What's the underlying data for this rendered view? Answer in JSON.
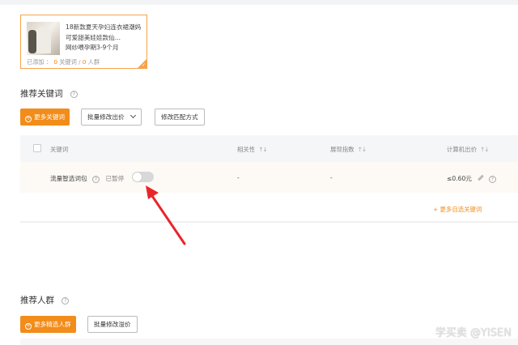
{
  "product": {
    "title": "18新款夏天孕妇连衣裙潮妈可爱甜美娃娃款仙...",
    "subtitle": "网纱喂孕期3-9个月",
    "added_label": "已添加 ：",
    "keyword_count": "0",
    "keyword_label": "关键词 /",
    "crowd_count": "0",
    "crowd_label": "人群"
  },
  "keywords_section": {
    "title": "推荐关键词",
    "add_button": "更多关键词",
    "bulk_bid_button": "批量修改出价",
    "match_button": "修改匹配方式"
  },
  "table": {
    "headers": {
      "keyword": "关键词",
      "relevance": "相关性",
      "impressions": "展现指数",
      "bid": "计算机出价"
    },
    "rows": [
      {
        "keyword": "流量智选词包",
        "status": "已暂停",
        "relevance": "-",
        "impressions": "-",
        "bid": "≤0.60元"
      }
    ]
  },
  "more_keywords_link": "+ 更多自选关键词",
  "crowd_section": {
    "title": "推荐人群",
    "add_button": "更多精选人群",
    "bulk_bid_button": "批量修改溢价"
  },
  "watermark": "学买卖 @YISEN",
  "colors": {
    "accent": "#f28c1a",
    "card_border": "#f7a34a",
    "annotation_arrow": "#e8262a"
  }
}
